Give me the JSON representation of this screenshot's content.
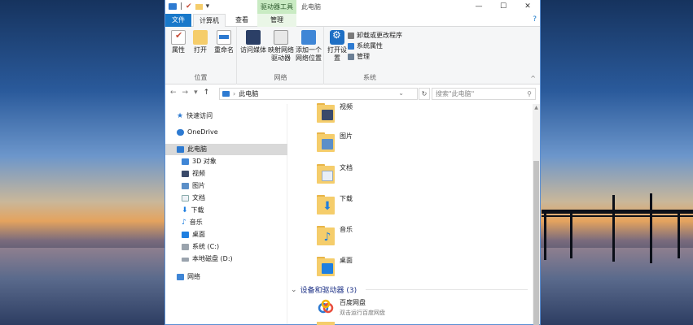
{
  "window": {
    "title": "此电脑",
    "context_tab": "驱动器工具",
    "controls": {
      "minimize": "—",
      "maximize": "☐",
      "close": "✕"
    }
  },
  "tabs": {
    "file": "文件",
    "computer": "计算机",
    "view": "查看",
    "manage": "管理"
  },
  "ribbon": {
    "location_group": {
      "label": "位置",
      "properties": "属性",
      "open": "打开",
      "rename": "重命名"
    },
    "network_group": {
      "label": "网络",
      "access_media": "访问媒体",
      "map_drive": "映射网络驱动器",
      "add_location": "添加一个网络位置"
    },
    "system_group": {
      "label": "系统",
      "open_settings": "打开设置",
      "uninstall": "卸载或更改程序",
      "system_props": "系统属性",
      "manage": "管理"
    }
  },
  "address": {
    "path": "此电脑",
    "search_placeholder": "搜索\"此电脑\""
  },
  "nav_pane": {
    "quick_access": "快速访问",
    "onedrive": "OneDrive",
    "this_pc": "此电脑",
    "objects3d": "3D 对象",
    "videos": "视频",
    "pictures": "图片",
    "documents": "文档",
    "downloads": "下载",
    "music": "音乐",
    "desktop": "桌面",
    "system_c": "系统 (C:)",
    "local_d": "本地磁盘 (D:)",
    "network": "网络"
  },
  "folders": [
    {
      "name": "视频",
      "overlay_color": "#3a4a6a"
    },
    {
      "name": "图片",
      "overlay_color": "#5b8fc8"
    },
    {
      "name": "文档",
      "overlay_color": "#e8eef6"
    },
    {
      "name": "下载",
      "overlay_color": "#1f7fe0"
    },
    {
      "name": "音乐",
      "overlay_color": "#1f7fe0"
    },
    {
      "name": "桌面",
      "overlay_color": "#1f7fe0"
    }
  ],
  "devices_section": {
    "header": "设备和驱动器 (3)",
    "items": [
      {
        "name": "百度网盘",
        "sub": "双击运行百度网盘"
      }
    ]
  },
  "colors": {
    "accent": "#1979ca",
    "selection": "#d9d9d9",
    "context_tab": "#c9ebc3"
  }
}
